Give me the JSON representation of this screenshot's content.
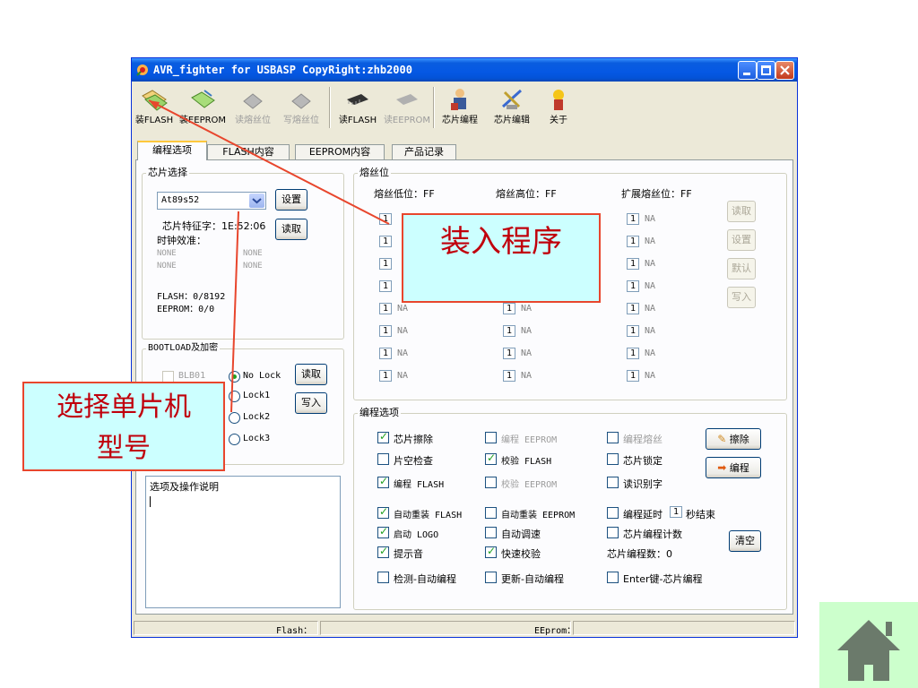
{
  "window": {
    "title": "AVR_fighter for USBASP CopyRight:zhb2000"
  },
  "toolbar": {
    "load_flash": "装FLASH",
    "load_eeprom": "装EEPROM",
    "read_fuse": "读熔丝位",
    "write_fuse": "写熔丝位",
    "read_flash": "读FLASH",
    "read_eeprom": "读EEPROM",
    "chip_program": "芯片编程",
    "chip_edit": "芯片编辑",
    "about": "关于"
  },
  "tabs": [
    "编程选项",
    "FLASH内容",
    "EEPROM内容",
    "产品记录"
  ],
  "chip_select": {
    "title": "芯片选择",
    "selected": "At89s52",
    "set_button": "设置",
    "signature_label": "芯片特征字：1E:52:06",
    "read_button": "读取",
    "clock_label": "时钟效准：",
    "none_1": "NONE",
    "none_2": "NONE",
    "none_3": "NONE",
    "none_4": "NONE",
    "flash_info": "FLASH：0/8192",
    "eeprom_info": "EEPROM：0/0"
  },
  "bootload": {
    "title": "BOOTLOAD及加密",
    "blb01": "BLB01",
    "no_lock": "No Lock",
    "lock1": "Lock1",
    "lock2": "Lock2",
    "lock3": "Lock3",
    "read_button": "读取",
    "write_button": "写入"
  },
  "notes": {
    "title": "选项及操作说明"
  },
  "fuse": {
    "title": "熔丝位",
    "low_label": "熔丝低位：FF",
    "high_label": "熔丝高位：FF",
    "ext_label": "扩展熔丝位：FF",
    "bit_value": "1",
    "na": "NA",
    "read_button": "读取",
    "set_button": "设置",
    "default_button": "默认",
    "write_button": "写入"
  },
  "program_options": {
    "title": "编程选项",
    "chip_erase": "芯片擦除",
    "prog_eeprom": "编程 EEPROM",
    "prog_fuse": "编程熔丝",
    "blank_check": "片空检查",
    "verify_flash": "校验 FLASH",
    "chip_lock": "芯片锁定",
    "prog_flash": "编程 FLASH",
    "verify_eeprom": "校验 EEPROM",
    "read_id": "读识别字",
    "auto_reload_flash": "自动重装 FLASH",
    "auto_reload_eeprom": "自动重装 EEPROM",
    "delay_label": "编程延时",
    "delay_value": "1",
    "delay_unit": "秒结束",
    "start_logo": "启动 LOGO",
    "auto_speed": "自动调速",
    "count_label": "芯片编程计数",
    "beep": "提示音",
    "fast_verify": "快速校验",
    "count_value": "芯片编程数：0",
    "detect_auto": "检测-自动编程",
    "update_auto": "更新-自动编程",
    "enter_key": "Enter键-芯片编程",
    "erase_button": "擦除",
    "program_button": "编程",
    "clear_button": "清空"
  },
  "statusbar": {
    "flash": "Flash：",
    "eeprom": "EEprom："
  },
  "callouts": {
    "load_program": "装入程序",
    "select_chip_line1": "选择单片机",
    "select_chip_line2": "型号"
  },
  "colors": {
    "accent_red": "#e8462d",
    "callout_fill": "#ccffff",
    "home_bg": "#ccffcc",
    "home_icon": "#6b7a6b"
  }
}
